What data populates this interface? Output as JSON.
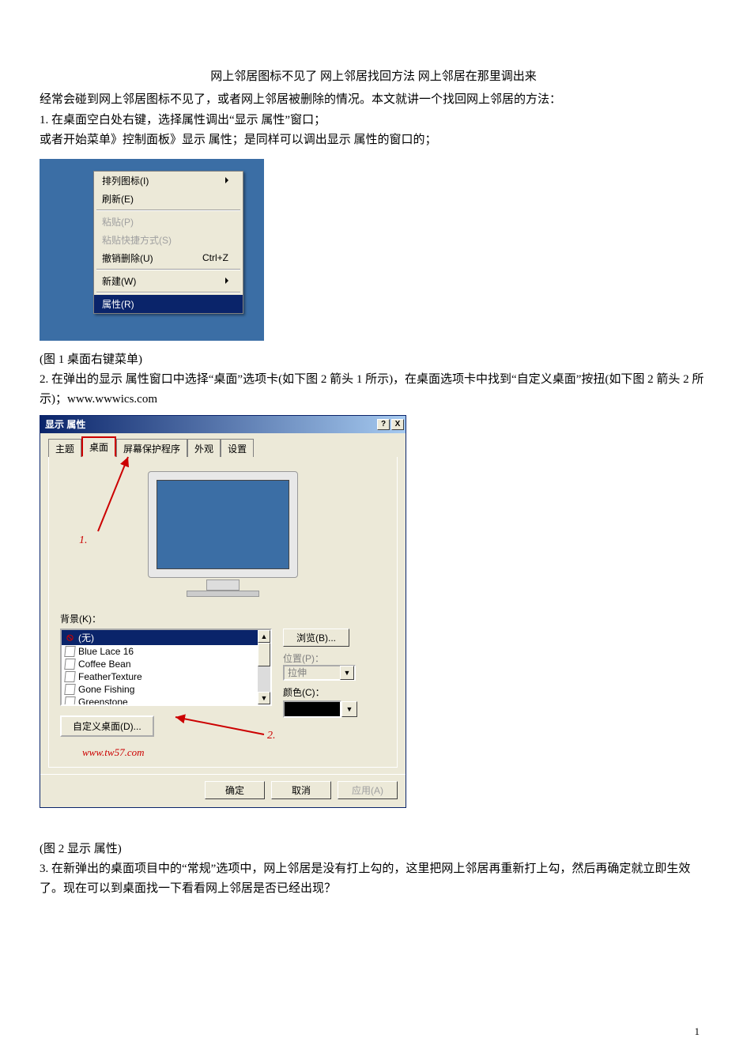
{
  "doc": {
    "title": "网上邻居图标不见了 网上邻居找回方法 网上邻居在那里调出来",
    "intro": "经常会碰到网上邻居图标不见了，或者网上邻居被删除的情况。本文就讲一个找回网上邻居的方法：",
    "step1a": "1. 在桌面空白处右键，选择属性调出“显示 属性”窗口；",
    "step1b": "或者开始菜单》控制面板》显示 属性；是同样可以调出显示 属性的窗口的；",
    "caption1": "(图 1 桌面右键菜单)",
    "step2": "2. 在弹出的显示 属性窗口中选择“桌面”选项卡(如下图 2 箭头 1 所示)，在桌面选项卡中找到“自定义桌面”按扭(如下图 2 箭头 2 所示)；www.wwwics.com",
    "caption2": "(图 2 显示 属性)",
    "step3": "3. 在新弹出的桌面项目中的“常规”选项中，网上邻居是没有打上勾的，这里把网上邻居再重新打上勾，然后再确定就立即生效了。现在可以到桌面找一下看看网上邻居是否已经出现？",
    "pagenum": "1"
  },
  "ctx": {
    "items": [
      {
        "label": "排列图标(I)",
        "arrow": true
      },
      {
        "label": "刷新(E)"
      }
    ],
    "group2": [
      {
        "label": "粘贴(P)",
        "disabled": true
      },
      {
        "label": "粘贴快捷方式(S)",
        "disabled": true
      },
      {
        "label": "撤销删除(U)",
        "shortcut": "Ctrl+Z"
      }
    ],
    "group3": [
      {
        "label": "新建(W)",
        "arrow": true
      }
    ],
    "prop": "属性(R)"
  },
  "dlg": {
    "title": "显示 属性",
    "help": "?",
    "close": "X",
    "tabs": [
      "主题",
      "桌面",
      "屏幕保护程序",
      "外观",
      "设置"
    ],
    "bg_label": "背景(K)：",
    "list": [
      "(无)",
      "Blue Lace 16",
      "Coffee Bean",
      "FeatherTexture",
      "Gone Fishing",
      "Greenstone"
    ],
    "browse": "浏览(B)...",
    "pos_label": "位置(P)：",
    "pos_value": "拉伸",
    "color_label": "颜色(C)：",
    "custom": "自定义桌面(D)...",
    "watermark": "www.tw57.com",
    "ok": "确定",
    "cancel": "取消",
    "apply": "应用(A)",
    "anno1": "1.",
    "anno2": "2."
  }
}
